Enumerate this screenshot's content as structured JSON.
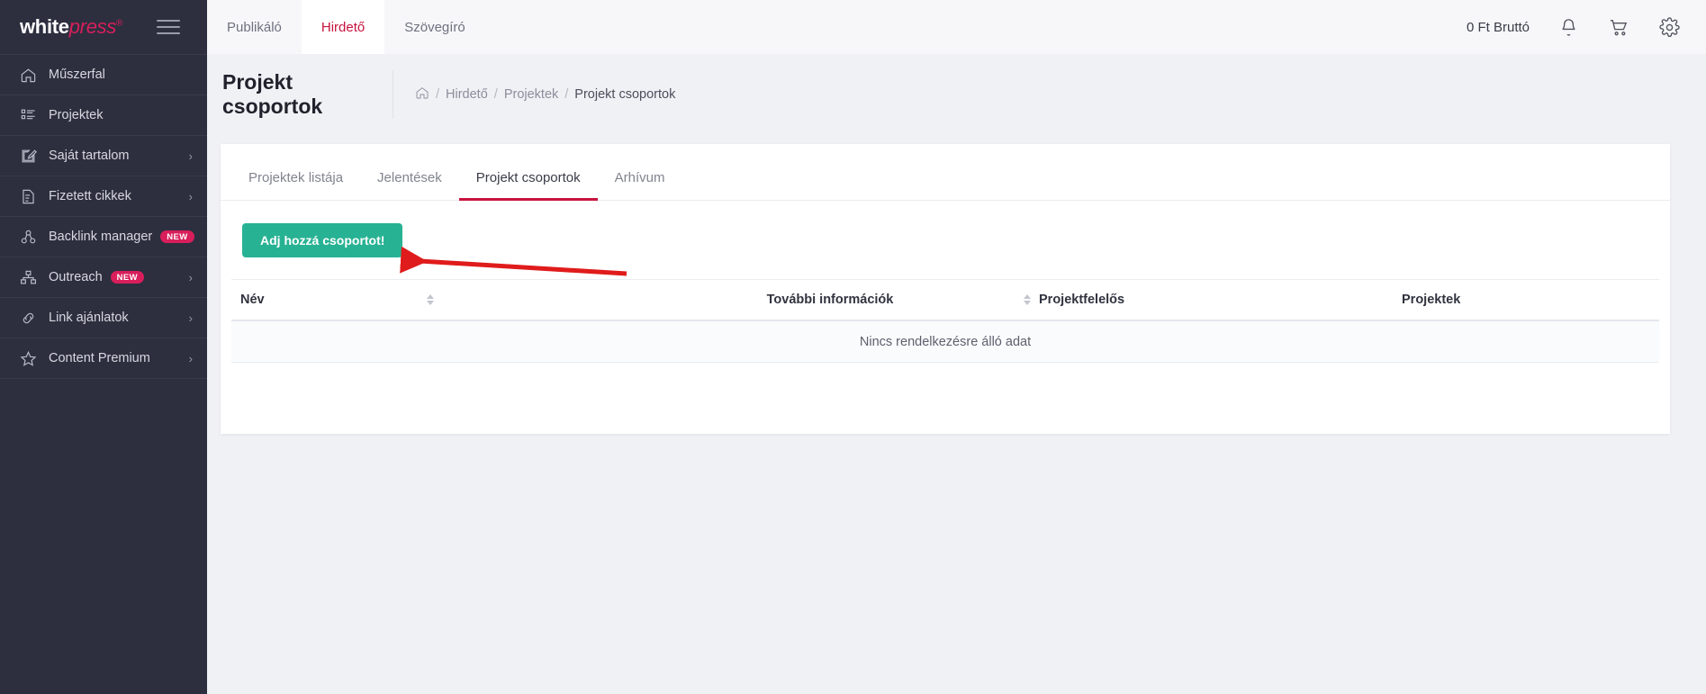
{
  "brand": {
    "name_part1": "white",
    "name_part2": "press",
    "registered": "®",
    "menu_icon": "hamburger-icon"
  },
  "sidebar": {
    "items": [
      {
        "label": "Műszerfal",
        "icon": "home-icon",
        "badge": "",
        "has_chevron": false
      },
      {
        "label": "Projektek",
        "icon": "list-icon",
        "badge": "",
        "has_chevron": false
      },
      {
        "label": "Saját tartalom",
        "icon": "edit-document-icon",
        "badge": "",
        "has_chevron": true
      },
      {
        "label": "Fizetett cikkek",
        "icon": "invoice-icon",
        "badge": "",
        "has_chevron": true
      },
      {
        "label": "Backlink manager",
        "icon": "link-network-icon",
        "badge": "NEW",
        "has_chevron": false
      },
      {
        "label": "Outreach",
        "icon": "sitemap-icon",
        "badge": "NEW",
        "has_chevron": true
      },
      {
        "label": "Link ajánlatok",
        "icon": "chain-link-icon",
        "badge": "",
        "has_chevron": true
      },
      {
        "label": "Content Premium",
        "icon": "star-icon",
        "badge": "",
        "has_chevron": true
      }
    ]
  },
  "topbar": {
    "tabs": [
      {
        "label": "Publikáló",
        "active": false
      },
      {
        "label": "Hirdető",
        "active": true
      },
      {
        "label": "Szövegíró",
        "active": false
      }
    ],
    "balance": "0 Ft Bruttó",
    "icons": [
      {
        "name": "bell-icon"
      },
      {
        "name": "cart-icon"
      },
      {
        "name": "gear-icon"
      }
    ]
  },
  "page": {
    "title": "Projekt csoportok",
    "breadcrumb": {
      "home_icon": "home-icon",
      "items": [
        "Hirdető",
        "Projektek",
        "Projekt csoportok"
      ],
      "separator": "/"
    }
  },
  "card": {
    "tabs": [
      {
        "label": "Projektek listája",
        "active": false
      },
      {
        "label": "Jelentések",
        "active": false
      },
      {
        "label": "Projekt csoportok",
        "active": true
      },
      {
        "label": "Arhívum",
        "active": false
      }
    ],
    "add_button_label": "Adj hozzá csoportot!",
    "table": {
      "columns": [
        {
          "label": "Név",
          "sortable": true
        },
        {
          "label": "További információk",
          "sortable": true
        },
        {
          "label": "Projektfelelős",
          "sortable": true
        },
        {
          "label": "Projektek",
          "sortable": false
        }
      ],
      "rows": [],
      "empty_message": "Nincs rendelkezésre álló adat"
    }
  },
  "annotation": {
    "type": "arrow",
    "color": "#e01b1b",
    "points_to": "Adj hozzá csoportot!"
  },
  "colors": {
    "sidebar_bg": "#2d2f3f",
    "accent_pink": "#c8133e",
    "badge_new": "#d81e5b",
    "button_green": "#28b294",
    "page_bg": "#f0f1f5"
  }
}
